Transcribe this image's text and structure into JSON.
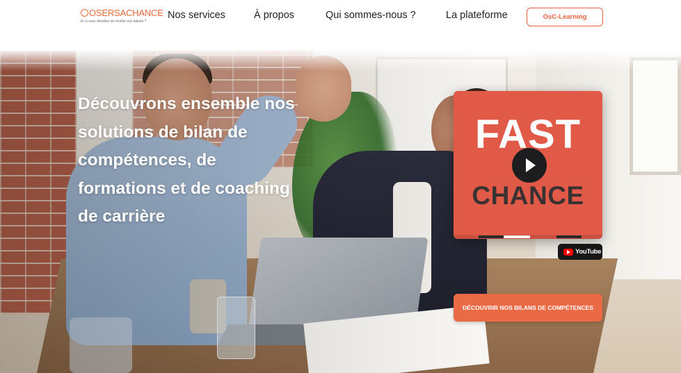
{
  "header": {
    "logo": {
      "text": "OSERSACHANCE",
      "tagline": "Et si vous décidiez de révéler vos talents ?"
    },
    "nav": [
      "Nos services",
      "À propos",
      "Qui sommes-nous ?",
      "La plateforme"
    ],
    "cta_label": "OsC-Learning"
  },
  "hero": {
    "headline": "Découvrons ensemble nos solutions de bilan de compétences, de formations et de coaching de carrière",
    "video": {
      "title_line1": "FAST",
      "title_line2": "CHANCE",
      "platform_label": "YouTube"
    },
    "cta_label": "DÉCOUVRIR NOS BILANS DE COMPÉTENCES"
  },
  "colors": {
    "brand_orange": "#e8623e",
    "video_red": "#e05a47",
    "text_dark": "#1f1f1f"
  }
}
